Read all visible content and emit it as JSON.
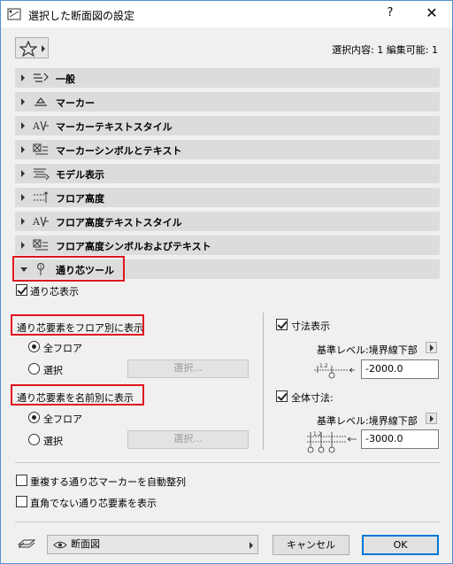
{
  "window": {
    "title": "選択した断面図の設定",
    "help": "?",
    "close": "✕"
  },
  "header": {
    "selection_info": "選択内容: 1 編集可能: 1"
  },
  "panels": [
    {
      "label": "一般",
      "icon": "general-icon"
    },
    {
      "label": "マーカー",
      "icon": "marker-icon"
    },
    {
      "label": "マーカーテキストスタイル",
      "icon": "text-style-icon"
    },
    {
      "label": "マーカーシンボルとテキスト",
      "icon": "symbol-text-icon"
    },
    {
      "label": "モデル表示",
      "icon": "model-display-icon"
    },
    {
      "label": "フロア高度",
      "icon": "floor-level-icon"
    },
    {
      "label": "フロア高度テキストスタイル",
      "icon": "text-style-icon"
    },
    {
      "label": "フロア高度シンボルおよびテキスト",
      "icon": "symbol-text-icon"
    },
    {
      "label": "通り芯ツール",
      "icon": "grid-tool-icon"
    }
  ],
  "grid_tool": {
    "show_grid_label": "通り芯表示",
    "by_floor_title": "通り芯要素をフロア別に表示",
    "by_name_title": "通り芯要素を名前別に表示",
    "all_floors": "全フロア",
    "select": "選択",
    "select_button": "選択...",
    "dimension_label": "寸法表示",
    "base_level_label": "基準レベル:境界線下部",
    "dimension_value": "-2000.0",
    "overall_dim_label": "全体寸法:",
    "overall_value": "-3000.0",
    "auto_arrange_label": "重複する通り芯マーカーを自動整列",
    "non_ortho_label": "直角でない通り芯要素を表示"
  },
  "footer": {
    "view_label": "断面図",
    "cancel": "キャンセル",
    "ok": "OK"
  }
}
